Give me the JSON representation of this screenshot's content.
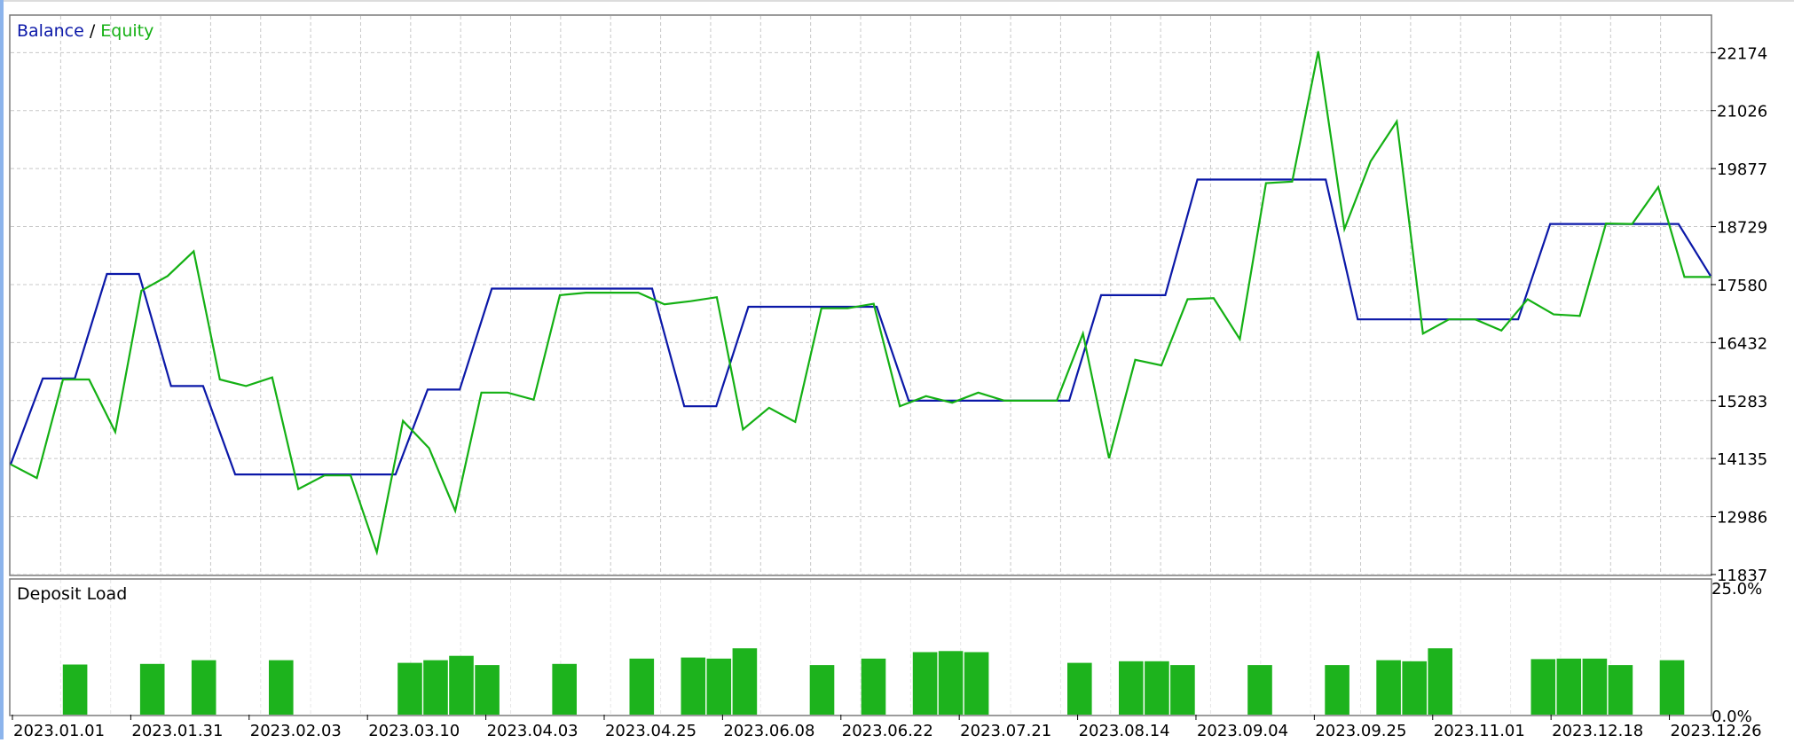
{
  "colors": {
    "balance": "#0b18a8",
    "equity": "#14b014",
    "bar": "#1db31d",
    "grid": "#c8c8c8",
    "frame": "#7a7a7a"
  },
  "legend": {
    "balance_label": "Balance",
    "separator": " / ",
    "equity_label": "Equity"
  },
  "deposit_panel": {
    "title": "Deposit Load"
  },
  "chart_data": [
    {
      "type": "line",
      "title": "Balance / Equity",
      "xlabel": "",
      "ylabel": "",
      "ylim": [
        11837,
        22900
      ],
      "y_ticks": [
        11837,
        12986,
        14135,
        15283,
        16432,
        17580,
        18729,
        19877,
        21026,
        22174
      ],
      "x_ticks": [
        "2023.01.01",
        "2023.01.31",
        "2023.02.03",
        "2023.03.10",
        "2023.04.03",
        "2023.04.25",
        "2023.06.08",
        "2023.06.22",
        "2023.07.21",
        "2023.08.14",
        "2023.09.04",
        "2023.09.25",
        "2023.11.01",
        "2023.12.18",
        "2023.12.26"
      ],
      "grid": true,
      "legend_position": "top-left",
      "series": [
        {
          "name": "Balance",
          "values": [
            14020,
            15720,
            15720,
            17790,
            17790,
            15570,
            15570,
            13820,
            13820,
            13820,
            13820,
            13820,
            13820,
            15500,
            15500,
            17500,
            17500,
            17500,
            17500,
            17500,
            17500,
            15170,
            15170,
            17140,
            17140,
            17140,
            17140,
            17140,
            15280,
            15280,
            15280,
            15280,
            15280,
            15280,
            17370,
            17370,
            17370,
            19660,
            19660,
            19660,
            19660,
            19660,
            16890,
            16890,
            16890,
            16890,
            16890,
            16890,
            18780,
            18780,
            18780,
            18780,
            18780,
            17750
          ]
        },
        {
          "name": "Equity",
          "values": [
            14020,
            13750,
            15700,
            15700,
            14660,
            17460,
            17750,
            18240,
            15700,
            15570,
            15740,
            13530,
            13800,
            13800,
            12280,
            14880,
            14340,
            13100,
            15440,
            15440,
            15300,
            17370,
            17420,
            17420,
            17420,
            17190,
            17250,
            17330,
            14710,
            15140,
            14860,
            17110,
            17110,
            17200,
            15170,
            15370,
            15240,
            15440,
            15280,
            15280,
            15280,
            16610,
            14140,
            16090,
            15980,
            17290,
            17310,
            16500,
            19590,
            19620,
            22200,
            18680,
            20020,
            20810,
            16610,
            16890,
            16890,
            16670,
            17290,
            16990,
            16960,
            18790,
            18780,
            19510,
            17730,
            17730
          ]
        }
      ]
    },
    {
      "type": "bar",
      "title": "Deposit Load",
      "xlabel": "",
      "ylabel": "",
      "ylim": [
        0,
        25
      ],
      "y_ticks": [
        "25.0%",
        "0.0%"
      ],
      "grid": false,
      "values": [
        0,
        0,
        9.3,
        0,
        0,
        9.4,
        0,
        10.1,
        0,
        0,
        10.1,
        0,
        0,
        0,
        0,
        9.6,
        10.1,
        10.9,
        9.2,
        0,
        0,
        9.4,
        0,
        0,
        10.4,
        0,
        10.6,
        10.4,
        12.3,
        0,
        0,
        9.2,
        0,
        10.4,
        0,
        11.6,
        11.8,
        11.6,
        0,
        0,
        0,
        9.6,
        0,
        9.9,
        9.9,
        9.2,
        0,
        0,
        9.2,
        0,
        0,
        9.2,
        0,
        10.1,
        9.9,
        12.3,
        0,
        0,
        0,
        10.3,
        10.4,
        10.4,
        9.2,
        0,
        10.1,
        0
      ]
    }
  ]
}
